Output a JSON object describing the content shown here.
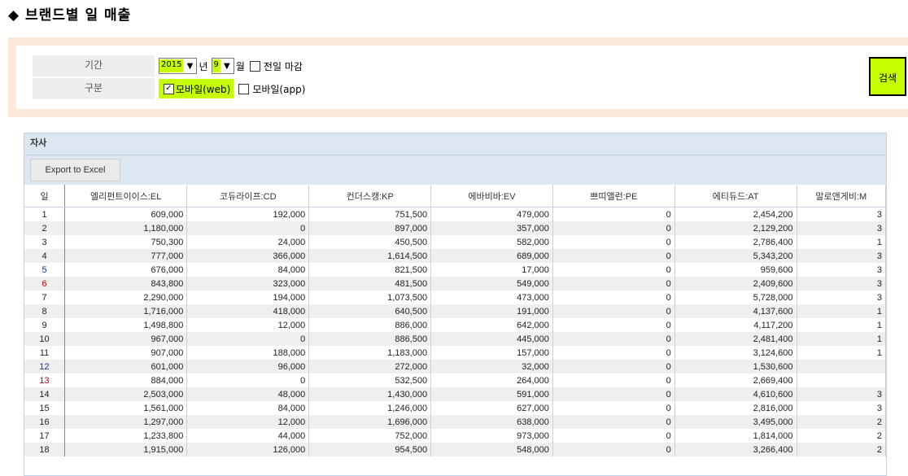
{
  "page": {
    "title": "◆ 브랜드별 일 매출"
  },
  "filter": {
    "period_label": "기간",
    "year_value": "2015",
    "year_suffix": "년",
    "month_value": "9",
    "month_suffix": "월",
    "prevday_label": "전일 마감",
    "type_label": "구분",
    "mobile_web_label": "모바일(web)",
    "mobile_app_label": "모바일(app)",
    "search_button": "검색"
  },
  "panel": {
    "title": "자사",
    "export_label": "Export to Excel",
    "columns": [
      "일",
      "엘리펀트이이스:EL",
      "코듀라이프:CD",
      "컨더스캥:KP",
      "에바비바:EV",
      "쁘띠앨런:PE",
      "에티듀드:AT",
      "말로앤게비:M"
    ],
    "rows": [
      {
        "day": "1",
        "c": [
          "609,000",
          "192,000",
          "751,500",
          "479,000",
          "0",
          "2,454,200",
          "3"
        ]
      },
      {
        "day": "2",
        "c": [
          "1,180,000",
          "0",
          "897,000",
          "357,000",
          "0",
          "2,129,200",
          "3"
        ]
      },
      {
        "day": "3",
        "c": [
          "750,300",
          "24,000",
          "450,500",
          "582,000",
          "0",
          "2,786,400",
          "1"
        ]
      },
      {
        "day": "4",
        "c": [
          "777,000",
          "366,000",
          "1,614,500",
          "689,000",
          "0",
          "5,343,200",
          "3"
        ]
      },
      {
        "day": "5",
        "c": [
          "676,000",
          "84,000",
          "821,500",
          "17,000",
          "0",
          "959,600",
          "3"
        ],
        "color": "blue"
      },
      {
        "day": "6",
        "c": [
          "843,800",
          "323,000",
          "481,500",
          "549,000",
          "0",
          "2,409,600",
          "3"
        ],
        "color": "red"
      },
      {
        "day": "7",
        "c": [
          "2,290,000",
          "194,000",
          "1,073,500",
          "473,000",
          "0",
          "5,728,000",
          "3"
        ]
      },
      {
        "day": "8",
        "c": [
          "1,716,000",
          "418,000",
          "640,500",
          "191,000",
          "0",
          "4,137,600",
          "1"
        ]
      },
      {
        "day": "9",
        "c": [
          "1,498,800",
          "12,000",
          "886,000",
          "642,000",
          "0",
          "4,117,200",
          "1"
        ]
      },
      {
        "day": "10",
        "c": [
          "967,000",
          "0",
          "886,500",
          "445,000",
          "0",
          "2,481,400",
          "1"
        ]
      },
      {
        "day": "11",
        "c": [
          "907,000",
          "188,000",
          "1,183,000",
          "157,000",
          "0",
          "3,124,600",
          "1"
        ]
      },
      {
        "day": "12",
        "c": [
          "601,000",
          "96,000",
          "272,000",
          "32,000",
          "0",
          "1,530,600",
          ""
        ],
        "color": "blue"
      },
      {
        "day": "13",
        "c": [
          "884,000",
          "0",
          "532,500",
          "264,000",
          "0",
          "2,669,400",
          ""
        ],
        "color": "red"
      },
      {
        "day": "14",
        "c": [
          "2,503,000",
          "48,000",
          "1,430,000",
          "591,000",
          "0",
          "4,610,600",
          "3"
        ]
      },
      {
        "day": "15",
        "c": [
          "1,561,000",
          "84,000",
          "1,246,000",
          "627,000",
          "0",
          "2,816,000",
          "3"
        ]
      },
      {
        "day": "16",
        "c": [
          "1,297,000",
          "12,000",
          "1,696,000",
          "638,000",
          "0",
          "3,495,000",
          "2"
        ]
      },
      {
        "day": "17",
        "c": [
          "1,233,800",
          "44,000",
          "752,000",
          "973,000",
          "0",
          "1,814,000",
          "2"
        ]
      },
      {
        "day": "18",
        "c": [
          "1,915,000",
          "126,000",
          "954,500",
          "548,000",
          "0",
          "3,266,400",
          "2"
        ]
      }
    ]
  }
}
